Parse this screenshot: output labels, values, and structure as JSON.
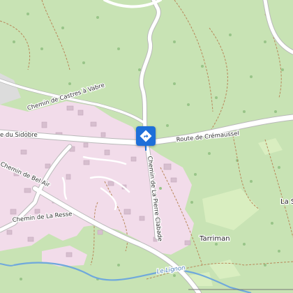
{
  "map": {
    "colors": {
      "forest": "#c8e3b4",
      "residential": "#f2dcea",
      "meadow": "#d9eec0",
      "road": "#ffffff",
      "road_casing": "#b9b9b9",
      "path": "#b8875a",
      "water": "#6fa8dc",
      "marker": "#1e6fd9"
    },
    "labels": {
      "road_castres": "Chemin de Castres à Vabre",
      "road_sidobre": "e du Sidobre",
      "road_cremaussel": "Route de Crémaussel",
      "road_belair": "Chemin de Bel Air",
      "road_resse": "Chemin de La Resse",
      "road_pierre": "Chemin de La Pierre Clabade",
      "place_tarriman": "Tarriman",
      "place_las": "La S",
      "river_lignon": "Le Lignon"
    },
    "marker": {
      "icon": "directions-icon"
    }
  }
}
